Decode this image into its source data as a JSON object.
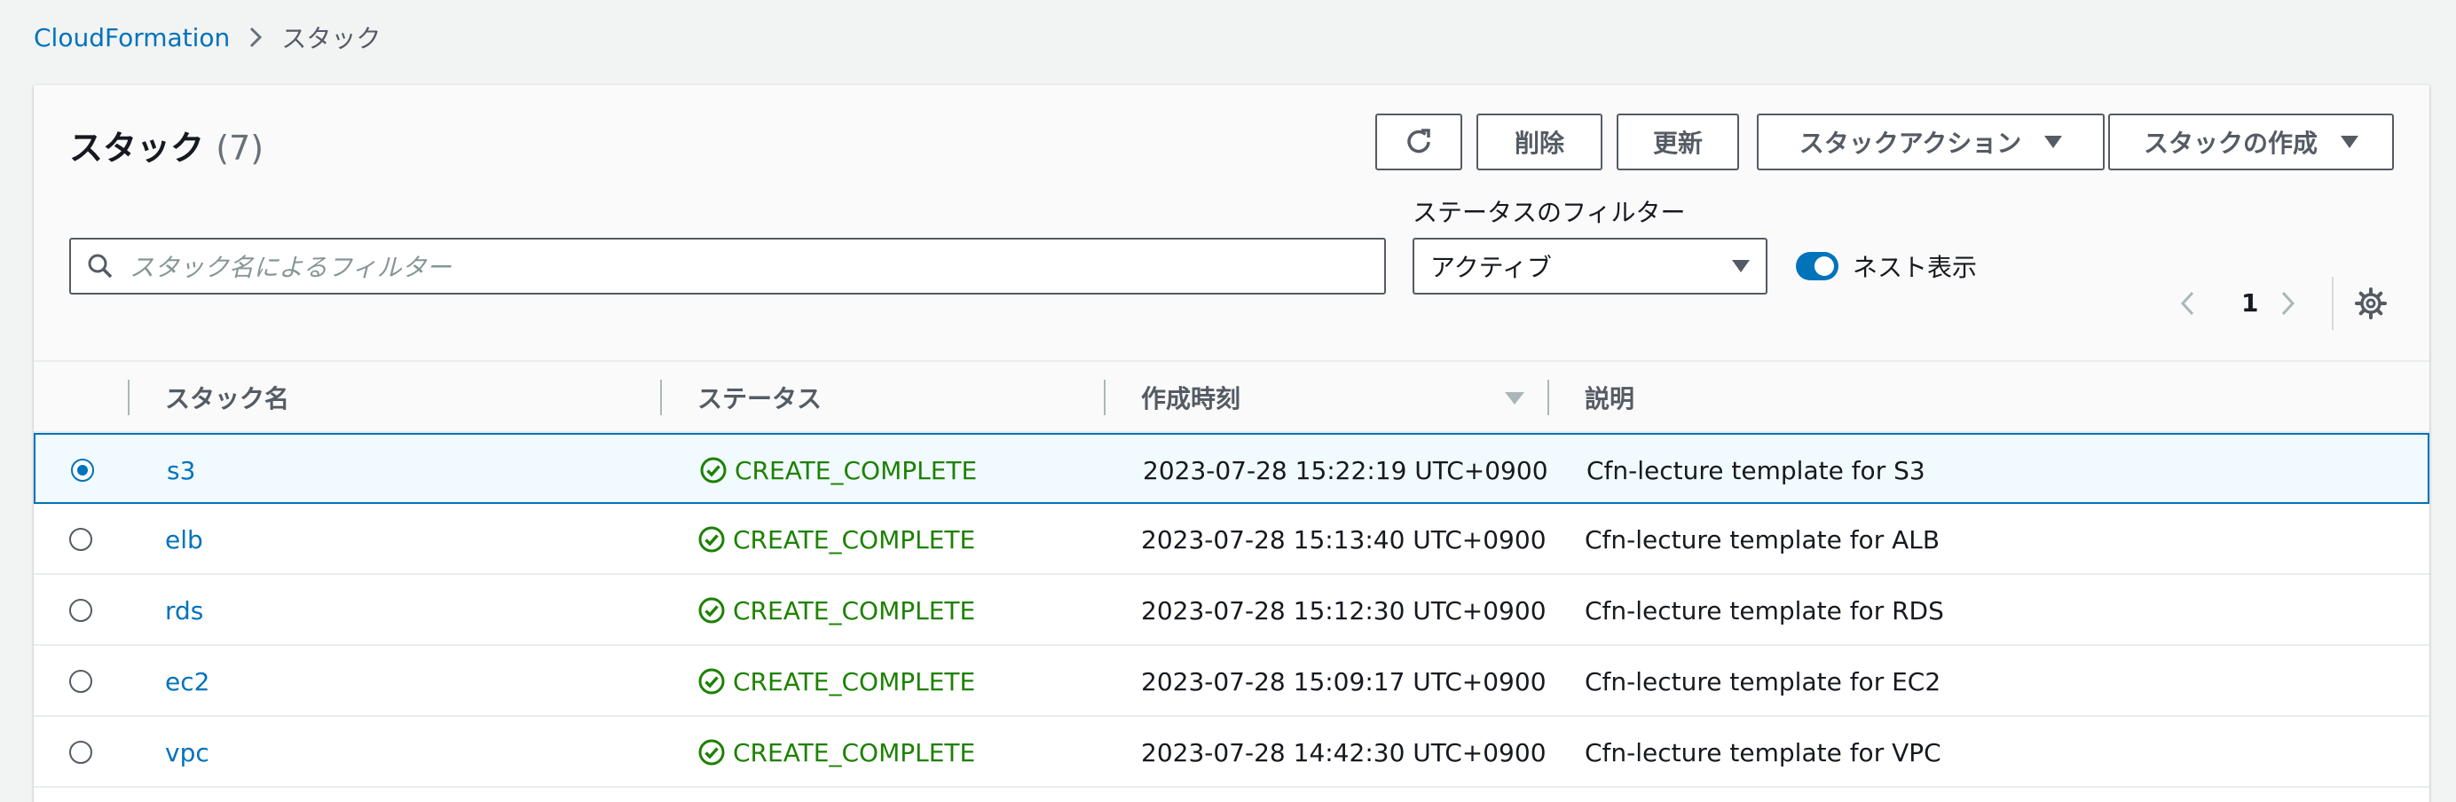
{
  "breadcrumb": {
    "root": "CloudFormation",
    "current": "スタック"
  },
  "header": {
    "title": "スタック",
    "count": "(7)"
  },
  "toolbar": {
    "delete_label": "削除",
    "update_label": "更新",
    "stack_actions_label": "スタックアクション",
    "create_stack_label": "スタックの作成"
  },
  "search": {
    "placeholder": "スタック名によるフィルター"
  },
  "status_filter": {
    "label": "ステータスのフィルター",
    "value": "アクティブ"
  },
  "nested_toggle": {
    "label": "ネスト表示",
    "on": true
  },
  "pagination": {
    "page": "1"
  },
  "table": {
    "columns": [
      "スタック名",
      "ステータス",
      "作成時刻",
      "説明"
    ],
    "sorted_column": "作成時刻",
    "rows": [
      {
        "name": "s3",
        "status": "CREATE_COMPLETE",
        "created": "2023-07-28 15:22:19 UTC+0900",
        "description": "Cfn-lecture template for S3",
        "selected": true
      },
      {
        "name": "elb",
        "status": "CREATE_COMPLETE",
        "created": "2023-07-28 15:13:40 UTC+0900",
        "description": "Cfn-lecture template for ALB",
        "selected": false
      },
      {
        "name": "rds",
        "status": "CREATE_COMPLETE",
        "created": "2023-07-28 15:12:30 UTC+0900",
        "description": "Cfn-lecture template for RDS",
        "selected": false
      },
      {
        "name": "ec2",
        "status": "CREATE_COMPLETE",
        "created": "2023-07-28 15:09:17 UTC+0900",
        "description": "Cfn-lecture template for EC2",
        "selected": false
      },
      {
        "name": "vpc",
        "status": "CREATE_COMPLETE",
        "created": "2023-07-28 14:42:30 UTC+0900",
        "description": "Cfn-lecture template for VPC",
        "selected": false
      }
    ]
  },
  "colors": {
    "link": "#0073bb",
    "success": "#1d8102",
    "border": "#545b64",
    "selected_bg": "#f1faff"
  },
  "icons": [
    "refresh-icon",
    "search-icon",
    "caret-down-icon",
    "chevron-right-icon",
    "chevron-left-icon",
    "settings-icon",
    "status-success-icon"
  ]
}
